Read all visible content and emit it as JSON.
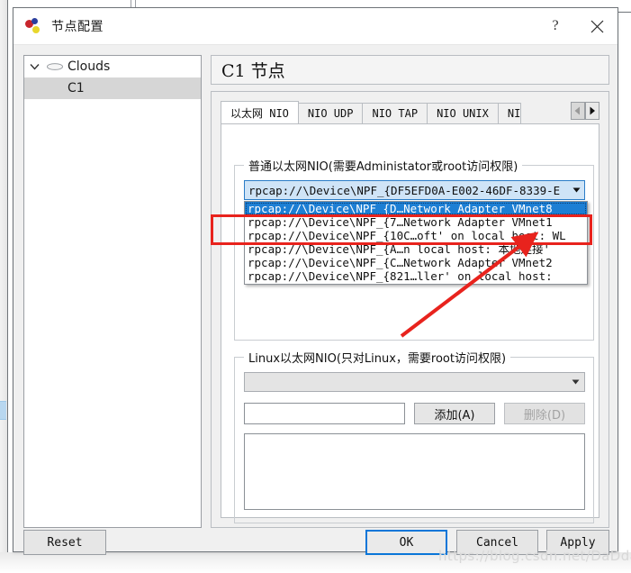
{
  "window": {
    "title": "节点配置",
    "icon": "balloons-icon",
    "help_label": "?",
    "close_label": "✕"
  },
  "tree": {
    "root": {
      "label": "Clouds",
      "icon": "cloud-icon",
      "expanded": true,
      "chevron": "⌄"
    },
    "children": [
      {
        "label": "C1",
        "selected": true
      }
    ]
  },
  "node_header": {
    "title": "C1 节点"
  },
  "tabs": {
    "items": [
      {
        "label": "以太网 NIO",
        "active": true
      },
      {
        "label": "NIO UDP",
        "active": false
      },
      {
        "label": "NIO TAP",
        "active": false
      },
      {
        "label": "NIO UNIX",
        "active": false
      },
      {
        "label": "NI",
        "active": false,
        "clipped": true
      }
    ],
    "scroll_left": "◀",
    "scroll_right": "▶"
  },
  "ethernet_group": {
    "legend": "普通以太网NIO(需要Administator或root访问权限)",
    "combo_value": "rpcap://\\Device\\NPF_{DF5EFD0A-E002-46DF-8339-E",
    "combo_arrow": "▼",
    "dropdown_open": true,
    "options": [
      {
        "text": "rpcap://\\Device\\NPF_{D…Network Adapter VMnet8",
        "selected": true
      },
      {
        "text": "rpcap://\\Device\\NPF_{7…Network Adapter VMnet1",
        "selected": false
      },
      {
        "text": "rpcap://\\Device\\NPF_{10C…oft' on local host: WL",
        "selected": false
      },
      {
        "text": "rpcap://\\Device\\NPF_{A…n local host: 本地连接' ",
        "selected": false
      },
      {
        "text": "rpcap://\\Device\\NPF_{C…Network Adapter VMnet2",
        "selected": false
      },
      {
        "text": "rpcap://\\Device\\NPF_{821…ller' on local host: ",
        "selected": false
      }
    ]
  },
  "linux_group": {
    "legend": "Linux以太网NIO(只对Linux，需要root访问权限)",
    "combo_value": "",
    "combo_arrow": "▼",
    "combo_disabled": true,
    "input_value": "",
    "add_label": "添加(A)",
    "delete_label": "删除(D)",
    "delete_disabled": true
  },
  "footer": {
    "reset_label": "Reset",
    "ok_label": "OK",
    "cancel_label": "Cancel",
    "apply_label": "Apply"
  },
  "annotations": {
    "highlight_color": "#e8231d",
    "arrow_color": "#e8231d",
    "watermark": "https://blog.csdn.net/DaDdai"
  }
}
